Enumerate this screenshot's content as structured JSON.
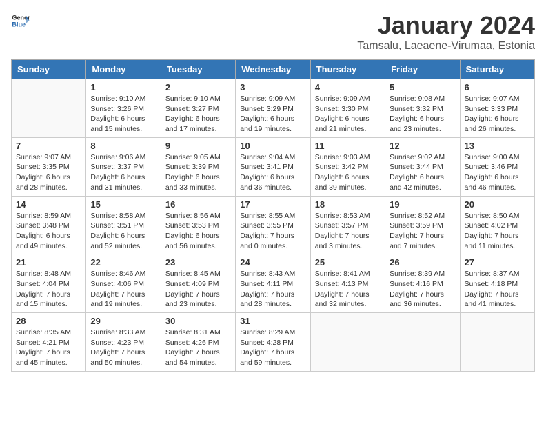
{
  "header": {
    "logo_general": "General",
    "logo_blue": "Blue",
    "month": "January 2024",
    "location": "Tamsalu, Laeaene-Virumaa, Estonia"
  },
  "weekdays": [
    "Sunday",
    "Monday",
    "Tuesday",
    "Wednesday",
    "Thursday",
    "Friday",
    "Saturday"
  ],
  "weeks": [
    [
      {
        "day": "",
        "info": ""
      },
      {
        "day": "1",
        "info": "Sunrise: 9:10 AM\nSunset: 3:26 PM\nDaylight: 6 hours\nand 15 minutes."
      },
      {
        "day": "2",
        "info": "Sunrise: 9:10 AM\nSunset: 3:27 PM\nDaylight: 6 hours\nand 17 minutes."
      },
      {
        "day": "3",
        "info": "Sunrise: 9:09 AM\nSunset: 3:29 PM\nDaylight: 6 hours\nand 19 minutes."
      },
      {
        "day": "4",
        "info": "Sunrise: 9:09 AM\nSunset: 3:30 PM\nDaylight: 6 hours\nand 21 minutes."
      },
      {
        "day": "5",
        "info": "Sunrise: 9:08 AM\nSunset: 3:32 PM\nDaylight: 6 hours\nand 23 minutes."
      },
      {
        "day": "6",
        "info": "Sunrise: 9:07 AM\nSunset: 3:33 PM\nDaylight: 6 hours\nand 26 minutes."
      }
    ],
    [
      {
        "day": "7",
        "info": "Sunrise: 9:07 AM\nSunset: 3:35 PM\nDaylight: 6 hours\nand 28 minutes."
      },
      {
        "day": "8",
        "info": "Sunrise: 9:06 AM\nSunset: 3:37 PM\nDaylight: 6 hours\nand 31 minutes."
      },
      {
        "day": "9",
        "info": "Sunrise: 9:05 AM\nSunset: 3:39 PM\nDaylight: 6 hours\nand 33 minutes."
      },
      {
        "day": "10",
        "info": "Sunrise: 9:04 AM\nSunset: 3:41 PM\nDaylight: 6 hours\nand 36 minutes."
      },
      {
        "day": "11",
        "info": "Sunrise: 9:03 AM\nSunset: 3:42 PM\nDaylight: 6 hours\nand 39 minutes."
      },
      {
        "day": "12",
        "info": "Sunrise: 9:02 AM\nSunset: 3:44 PM\nDaylight: 6 hours\nand 42 minutes."
      },
      {
        "day": "13",
        "info": "Sunrise: 9:00 AM\nSunset: 3:46 PM\nDaylight: 6 hours\nand 46 minutes."
      }
    ],
    [
      {
        "day": "14",
        "info": "Sunrise: 8:59 AM\nSunset: 3:48 PM\nDaylight: 6 hours\nand 49 minutes."
      },
      {
        "day": "15",
        "info": "Sunrise: 8:58 AM\nSunset: 3:51 PM\nDaylight: 6 hours\nand 52 minutes."
      },
      {
        "day": "16",
        "info": "Sunrise: 8:56 AM\nSunset: 3:53 PM\nDaylight: 6 hours\nand 56 minutes."
      },
      {
        "day": "17",
        "info": "Sunrise: 8:55 AM\nSunset: 3:55 PM\nDaylight: 7 hours\nand 0 minutes."
      },
      {
        "day": "18",
        "info": "Sunrise: 8:53 AM\nSunset: 3:57 PM\nDaylight: 7 hours\nand 3 minutes."
      },
      {
        "day": "19",
        "info": "Sunrise: 8:52 AM\nSunset: 3:59 PM\nDaylight: 7 hours\nand 7 minutes."
      },
      {
        "day": "20",
        "info": "Sunrise: 8:50 AM\nSunset: 4:02 PM\nDaylight: 7 hours\nand 11 minutes."
      }
    ],
    [
      {
        "day": "21",
        "info": "Sunrise: 8:48 AM\nSunset: 4:04 PM\nDaylight: 7 hours\nand 15 minutes."
      },
      {
        "day": "22",
        "info": "Sunrise: 8:46 AM\nSunset: 4:06 PM\nDaylight: 7 hours\nand 19 minutes."
      },
      {
        "day": "23",
        "info": "Sunrise: 8:45 AM\nSunset: 4:09 PM\nDaylight: 7 hours\nand 23 minutes."
      },
      {
        "day": "24",
        "info": "Sunrise: 8:43 AM\nSunset: 4:11 PM\nDaylight: 7 hours\nand 28 minutes."
      },
      {
        "day": "25",
        "info": "Sunrise: 8:41 AM\nSunset: 4:13 PM\nDaylight: 7 hours\nand 32 minutes."
      },
      {
        "day": "26",
        "info": "Sunrise: 8:39 AM\nSunset: 4:16 PM\nDaylight: 7 hours\nand 36 minutes."
      },
      {
        "day": "27",
        "info": "Sunrise: 8:37 AM\nSunset: 4:18 PM\nDaylight: 7 hours\nand 41 minutes."
      }
    ],
    [
      {
        "day": "28",
        "info": "Sunrise: 8:35 AM\nSunset: 4:21 PM\nDaylight: 7 hours\nand 45 minutes."
      },
      {
        "day": "29",
        "info": "Sunrise: 8:33 AM\nSunset: 4:23 PM\nDaylight: 7 hours\nand 50 minutes."
      },
      {
        "day": "30",
        "info": "Sunrise: 8:31 AM\nSunset: 4:26 PM\nDaylight: 7 hours\nand 54 minutes."
      },
      {
        "day": "31",
        "info": "Sunrise: 8:29 AM\nSunset: 4:28 PM\nDaylight: 7 hours\nand 59 minutes."
      },
      {
        "day": "",
        "info": ""
      },
      {
        "day": "",
        "info": ""
      },
      {
        "day": "",
        "info": ""
      }
    ]
  ]
}
